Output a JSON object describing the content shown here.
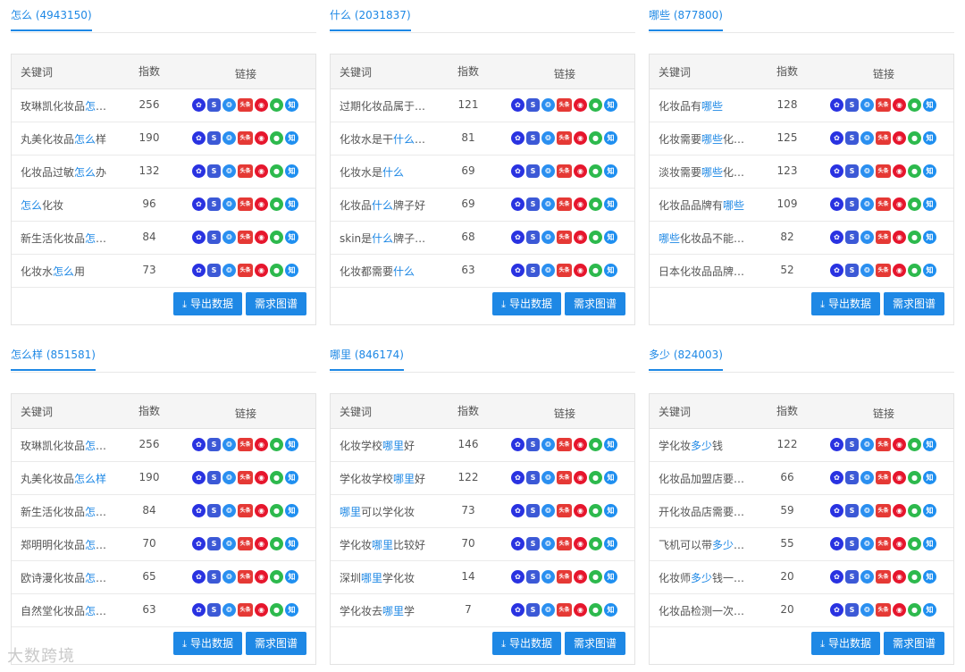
{
  "columns": {
    "keyword": "关键词",
    "index": "指数",
    "links": "链接"
  },
  "buttons": {
    "export": "导出数据",
    "graph": "需求图谱"
  },
  "watermark": "大数跨境",
  "panels": [
    {
      "title": "怎么 (4943150)",
      "rows": [
        {
          "pre": "玫琳凯化妆品",
          "hl": "怎",
          "post": "…",
          "value": "256"
        },
        {
          "pre": "丸美化妆品",
          "hl": "怎么",
          "post": "样",
          "value": "190"
        },
        {
          "pre": "化妆品过敏",
          "hl": "怎么",
          "post": "办",
          "value": "132"
        },
        {
          "pre": "",
          "hl": "怎么",
          "post": "化妆",
          "value": "96"
        },
        {
          "pre": "新生活化妆品",
          "hl": "怎",
          "post": "…",
          "value": "84"
        },
        {
          "pre": "化妆水",
          "hl": "怎么",
          "post": "用",
          "value": "73"
        }
      ]
    },
    {
      "title": "什么 (2031837)",
      "rows": [
        {
          "pre": "过期化妆品属于…",
          "hl": "",
          "post": "",
          "value": "121"
        },
        {
          "pre": "化妆水是干",
          "hl": "什么",
          "post": "…",
          "value": "81"
        },
        {
          "pre": "化妆水是",
          "hl": "什么",
          "post": "",
          "value": "69"
        },
        {
          "pre": "化妆品",
          "hl": "什么",
          "post": "牌子好",
          "value": "69"
        },
        {
          "pre": "skin是",
          "hl": "什么",
          "post": "牌子…",
          "value": "68"
        },
        {
          "pre": "化妆都需要",
          "hl": "什么",
          "post": "",
          "value": "63"
        }
      ]
    },
    {
      "title": "哪些 (877800)",
      "rows": [
        {
          "pre": "化妆品有",
          "hl": "哪些",
          "post": "",
          "value": "128"
        },
        {
          "pre": "化妆需要",
          "hl": "哪些",
          "post": "化…",
          "value": "125"
        },
        {
          "pre": "淡妆需要",
          "hl": "哪些",
          "post": "化…",
          "value": "123"
        },
        {
          "pre": "化妆品品牌有",
          "hl": "哪些",
          "post": "",
          "value": "109"
        },
        {
          "pre": "",
          "hl": "哪些",
          "post": "化妆品不能…",
          "value": "82"
        },
        {
          "pre": "日本化妆品品牌…",
          "hl": "",
          "post": "",
          "value": "52"
        }
      ]
    },
    {
      "title": "怎么样 (851581)",
      "rows": [
        {
          "pre": "玫琳凯化妆品",
          "hl": "怎",
          "post": "…",
          "value": "256"
        },
        {
          "pre": "丸美化妆品",
          "hl": "怎么样",
          "post": "",
          "value": "190"
        },
        {
          "pre": "新生活化妆品",
          "hl": "怎",
          "post": "…",
          "value": "84"
        },
        {
          "pre": "郑明明化妆品",
          "hl": "怎",
          "post": "…",
          "value": "70"
        },
        {
          "pre": "欧诗漫化妆品",
          "hl": "怎",
          "post": "…",
          "value": "65"
        },
        {
          "pre": "自然堂化妆品",
          "hl": "怎",
          "post": "…",
          "value": "63"
        }
      ]
    },
    {
      "title": "哪里 (846174)",
      "rows": [
        {
          "pre": "化妆学校",
          "hl": "哪里",
          "post": "好",
          "value": "146"
        },
        {
          "pre": "学化妆学校",
          "hl": "哪里",
          "post": "好",
          "value": "122"
        },
        {
          "pre": "",
          "hl": "哪里",
          "post": "可以学化妆",
          "value": "73"
        },
        {
          "pre": "学化妆",
          "hl": "哪里",
          "post": "比较好",
          "value": "70"
        },
        {
          "pre": "深圳",
          "hl": "哪里",
          "post": "学化妆",
          "value": "14"
        },
        {
          "pre": "学化妆去",
          "hl": "哪里",
          "post": "学",
          "value": "7"
        }
      ]
    },
    {
      "title": "多少 (824003)",
      "rows": [
        {
          "pre": "学化妆",
          "hl": "多少",
          "post": "钱",
          "value": "122"
        },
        {
          "pre": "化妆品加盟店要…",
          "hl": "",
          "post": "",
          "value": "66"
        },
        {
          "pre": "开化妆品店需要…",
          "hl": "",
          "post": "",
          "value": "59"
        },
        {
          "pre": "飞机可以带",
          "hl": "多少",
          "post": "…",
          "value": "55"
        },
        {
          "pre": "化妆师",
          "hl": "多少",
          "post": "钱一…",
          "value": "20"
        },
        {
          "pre": "化妆品检测一次…",
          "hl": "",
          "post": "",
          "value": "20"
        }
      ]
    }
  ],
  "icon_glyphs": {
    "baidu": "✿",
    "sogou": "S",
    "so360": "❂",
    "toutiao": "头条",
    "weibo": "◉",
    "wechat": "●",
    "zhihu": "知"
  }
}
